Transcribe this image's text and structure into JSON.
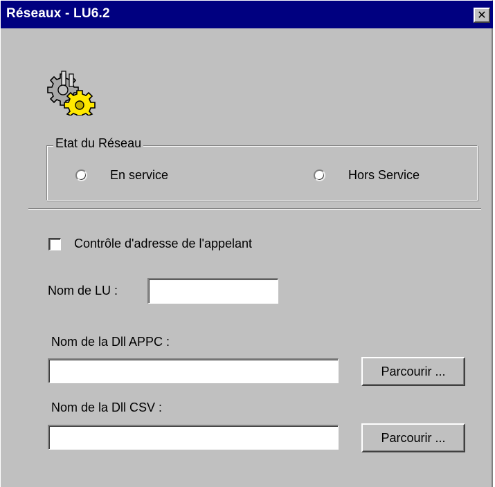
{
  "window": {
    "title": "Réseaux - LU6.2",
    "close_glyph": "✕"
  },
  "icon": {
    "name": "gears-icon",
    "colors": {
      "steel": "#a8a8a8",
      "gold": "#ffe800",
      "outline": "#000000"
    }
  },
  "network_state": {
    "legend": "Etat du Réseau",
    "options": [
      {
        "label": "En service",
        "selected": false
      },
      {
        "label": "Hors Service",
        "selected": false
      }
    ]
  },
  "caller_check": {
    "label": "Contrôle d'adresse de l'appelant",
    "checked": false
  },
  "lu_name": {
    "label": "Nom de LU :",
    "value": ""
  },
  "appc_dll": {
    "label": "Nom de la Dll APPC :",
    "value": "",
    "browse_label": "Parcourir ..."
  },
  "csv_dll": {
    "label": "Nom de la Dll CSV :",
    "value": "",
    "browse_label": "Parcourir ..."
  },
  "colors": {
    "face": "#c0c0c0",
    "titlebar": "#000080",
    "title_text": "#ffffff"
  }
}
